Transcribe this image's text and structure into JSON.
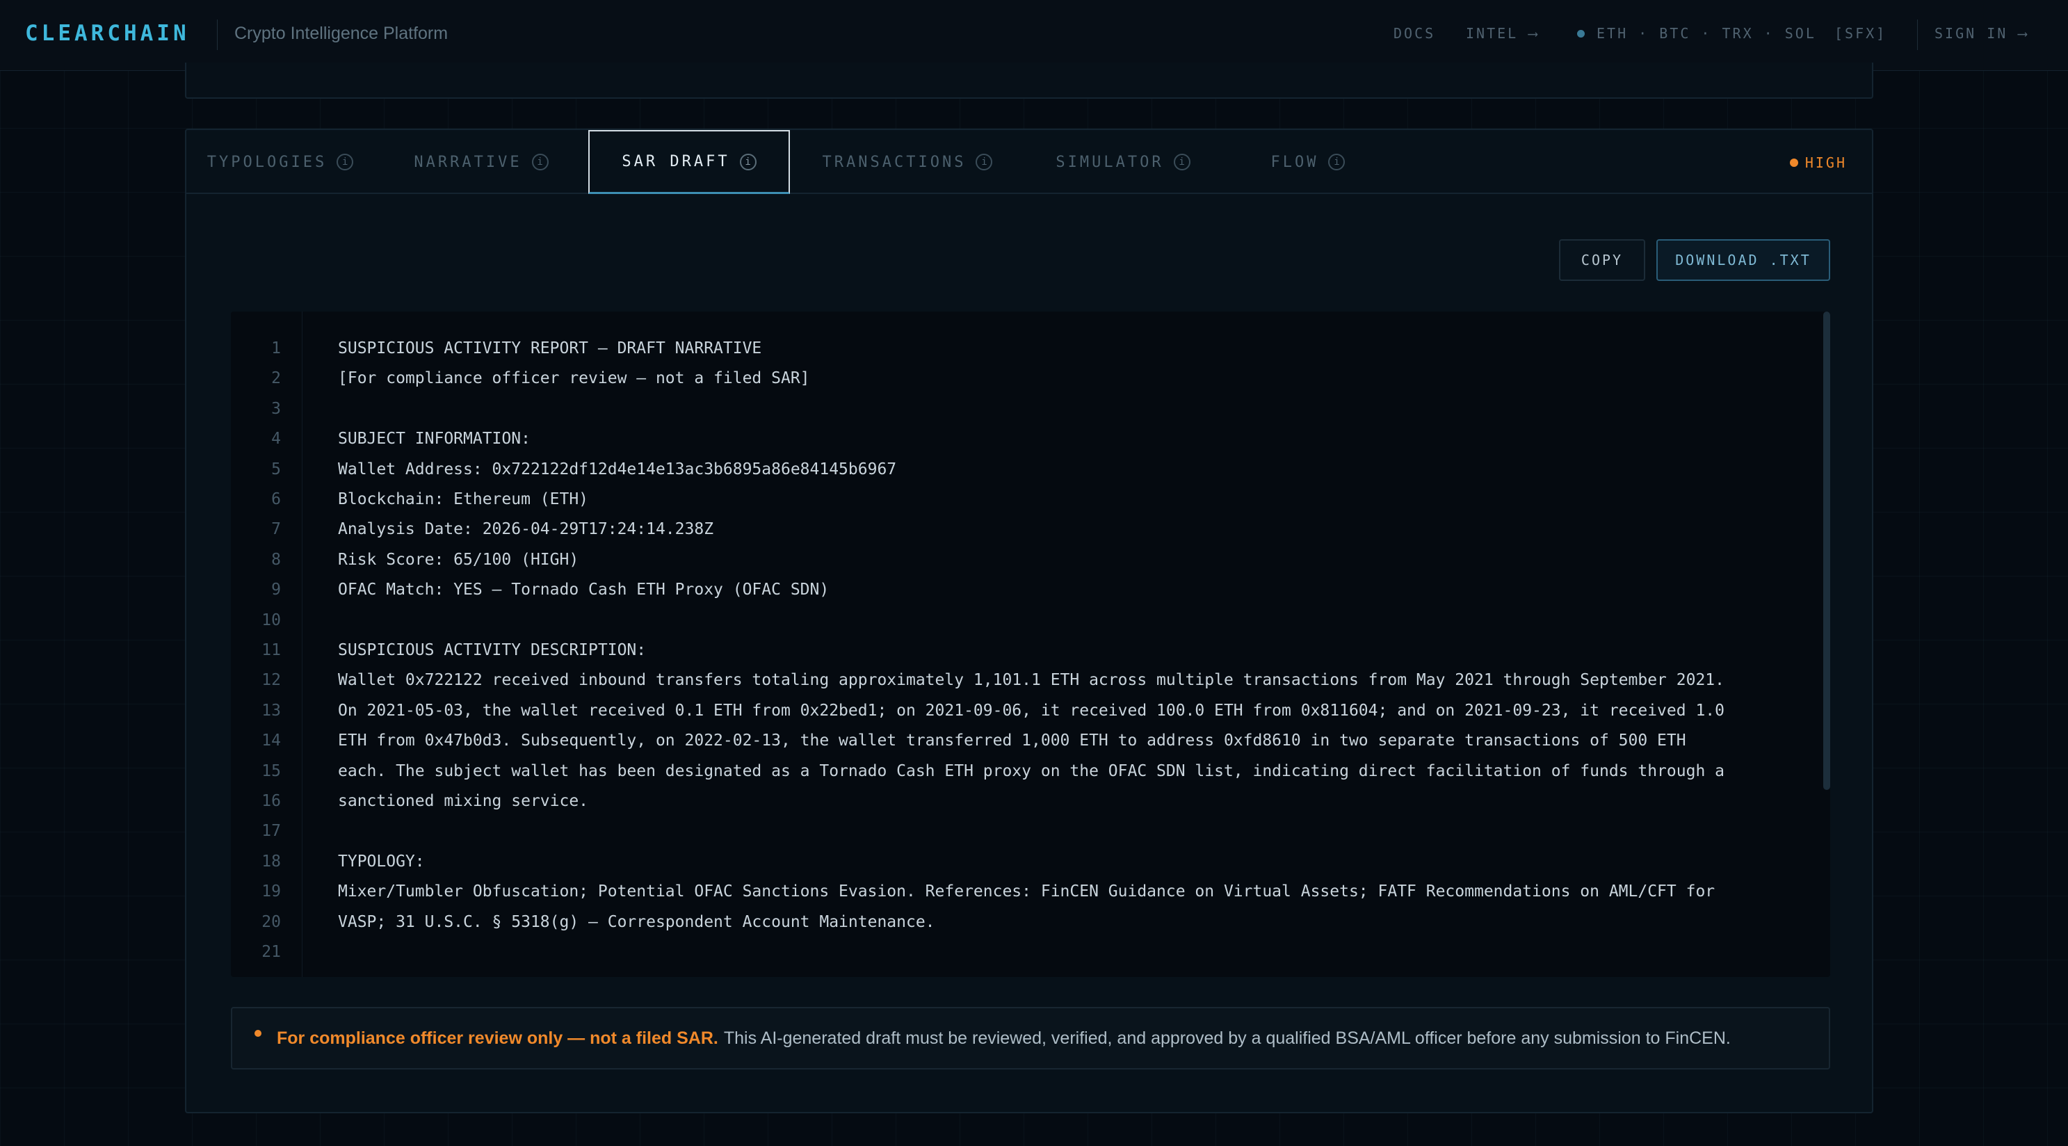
{
  "brand": {
    "logo": "CLEARCHAIN",
    "tagline": "Crypto Intelligence Platform"
  },
  "nav": {
    "docs": "DOCS",
    "intel": "INTEL ⟶",
    "chains": "ETH · BTC · TRX · SOL",
    "sfx": "[SFX]",
    "sign_in": "SIGN IN ⟶"
  },
  "tabs": [
    {
      "label": "TYPOLOGIES",
      "info": "i"
    },
    {
      "label": "NARRATIVE",
      "info": "i"
    },
    {
      "label": "SAR DRAFT",
      "info": "i",
      "active": true
    },
    {
      "label": "TRANSACTIONS",
      "info": "i"
    },
    {
      "label": "SIMULATOR",
      "info": "i"
    },
    {
      "label": "FLOW",
      "info": "i"
    }
  ],
  "risk": {
    "level": "HIGH",
    "color": "#f0892b"
  },
  "actions": {
    "copy": "COPY",
    "download": "DOWNLOAD .TXT"
  },
  "report_lines": [
    "SUSPICIOUS ACTIVITY REPORT — DRAFT NARRATIVE",
    "[For compliance officer review — not a filed SAR]",
    "",
    "SUBJECT INFORMATION:",
    "Wallet Address: 0x722122df12d4e14e13ac3b6895a86e84145b6967",
    "Blockchain: Ethereum (ETH)",
    "Analysis Date: 2026-04-29T17:24:14.238Z",
    "Risk Score: 65/100 (HIGH)",
    "OFAC Match: YES — Tornado Cash ETH Proxy (OFAC SDN)",
    "",
    "SUSPICIOUS ACTIVITY DESCRIPTION:",
    "Wallet 0x722122 received inbound transfers totaling approximately 1,101.1 ETH across multiple transactions from May 2021 through September 2021.",
    "On 2021-05-03, the wallet received 0.1 ETH from 0x22bed1; on 2021-09-06, it received 100.0 ETH from 0x811604; and on 2021-09-23, it received 1.0",
    "ETH from 0x47b0d3. Subsequently, on 2022-02-13, the wallet transferred 1,000 ETH to address 0xfd8610 in two separate transactions of 500 ETH",
    "each. The subject wallet has been designated as a Tornado Cash ETH proxy on the OFAC SDN list, indicating direct facilitation of funds through a",
    "sanctioned mixing service.",
    "",
    "TYPOLOGY:",
    "Mixer/Tumbler Obfuscation; Potential OFAC Sanctions Evasion. References: FinCEN Guidance on Virtual Assets; FATF Recommendations on AML/CFT for",
    "VASP; 31 U.S.C. § 5318(g) — Correspondent Account Maintenance.",
    ""
  ],
  "disclaimer": {
    "strong": "For compliance officer review only — not a filed SAR.",
    "text": "This AI-generated draft must be reviewed, verified, and approved by a qualified BSA/AML officer before any submission to FinCEN."
  }
}
